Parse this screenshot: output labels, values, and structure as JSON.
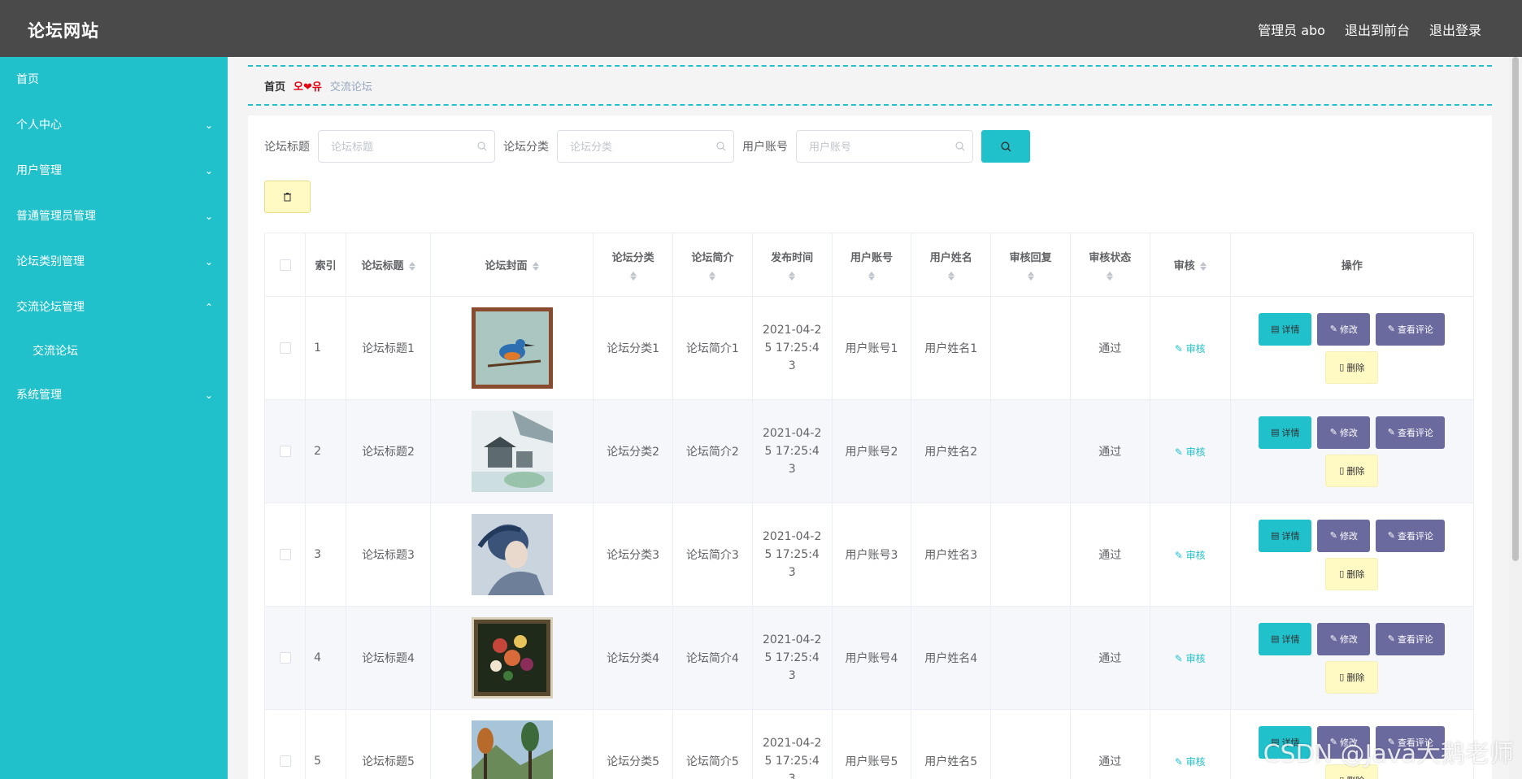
{
  "header": {
    "brand": "论坛网站",
    "nav": [
      "管理员 abo",
      "退出到前台",
      "退出登录"
    ]
  },
  "sidebar": {
    "items": [
      {
        "label": "首页",
        "chevron": ""
      },
      {
        "label": "个人中心",
        "chevron": "down"
      },
      {
        "label": "用户管理",
        "chevron": "down"
      },
      {
        "label": "普通管理员管理",
        "chevron": "down"
      },
      {
        "label": "论坛类别管理",
        "chevron": "down"
      },
      {
        "label": "交流论坛管理",
        "chevron": "up"
      }
    ],
    "sub_label": "交流论坛",
    "last_item": "系统管理"
  },
  "breadcrumb": {
    "home": "首页",
    "separator_left": "오",
    "separator_right": "유",
    "current": "交流论坛"
  },
  "search": {
    "title_label": "论坛标题",
    "title_placeholder": "论坛标题",
    "category_label": "论坛分类",
    "category_placeholder": "论坛分类",
    "account_label": "用户账号",
    "account_placeholder": "用户账号"
  },
  "table": {
    "headers": {
      "index": "索引",
      "title": "论坛标题",
      "cover": "论坛封面",
      "category": "论坛分类",
      "intro": "论坛简介",
      "time": "发布时间",
      "account": "用户账号",
      "name": "用户姓名",
      "reply": "审核回复",
      "status": "审核状态",
      "audit": "审核",
      "ops": "操作"
    },
    "rows": [
      {
        "index": "1",
        "title": "论坛标题1",
        "category": "论坛分类1",
        "intro": "论坛简介1",
        "time": "2021-04-25 17:25:43",
        "account": "用户账号1",
        "name": "用户姓名1",
        "reply": "",
        "status": "通过",
        "audit": "审核",
        "cover": "bird"
      },
      {
        "index": "2",
        "title": "论坛标题2",
        "category": "论坛分类2",
        "intro": "论坛简介2",
        "time": "2021-04-25 17:25:43",
        "account": "用户账号2",
        "name": "用户姓名2",
        "reply": "",
        "status": "通过",
        "audit": "审核",
        "cover": "house"
      },
      {
        "index": "3",
        "title": "论坛标题3",
        "category": "论坛分类3",
        "intro": "论坛简介3",
        "time": "2021-04-25 17:25:43",
        "account": "用户账号3",
        "name": "用户姓名3",
        "reply": "",
        "status": "通过",
        "audit": "审核",
        "cover": "portrait"
      },
      {
        "index": "4",
        "title": "论坛标题4",
        "category": "论坛分类4",
        "intro": "论坛简介4",
        "time": "2021-04-25 17:25:43",
        "account": "用户账号4",
        "name": "用户姓名4",
        "reply": "",
        "status": "通过",
        "audit": "审核",
        "cover": "flowers"
      },
      {
        "index": "5",
        "title": "论坛标题5",
        "category": "论坛分类5",
        "intro": "论坛简介5",
        "time": "2021-04-25 17:25:43",
        "account": "用户账号5",
        "name": "用户姓名5",
        "reply": "",
        "status": "通过",
        "audit": "审核",
        "cover": "forest"
      }
    ],
    "ops": {
      "detail": "详情",
      "edit": "修改",
      "comment": "查看评论",
      "remove": "删除"
    }
  },
  "watermark": "CSDN @Java大鹅老师",
  "colors": {
    "accent": "#21c1cc",
    "header": "#4a4a4a",
    "purple": "#6b6a9e",
    "yellow": "#fff9c4"
  }
}
